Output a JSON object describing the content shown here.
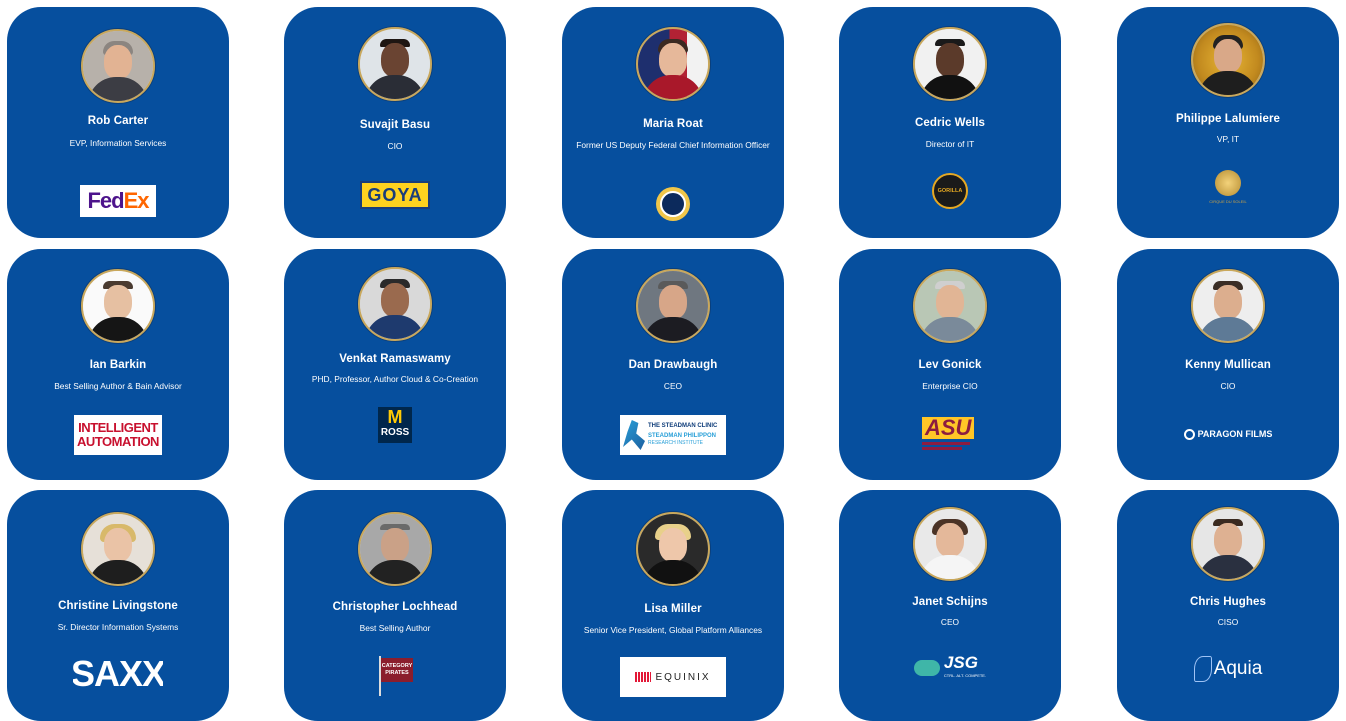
{
  "cards": [
    {
      "name": "Rob Carter",
      "title": "EVP, Information Services",
      "logo": "FedEx"
    },
    {
      "name": "Suvajit Basu",
      "title": "CIO",
      "logo": "GOYA"
    },
    {
      "name": "Maria Roat",
      "title": "Former US Deputy Federal Chief Information Officer",
      "logo": "navy-seal"
    },
    {
      "name": "Cedric Wells",
      "title": "Director of IT",
      "logo": "GORILLA"
    },
    {
      "name": "Philippe Lalumiere",
      "title": "VP, IT",
      "logo": "CIRQUE DU SOLEIL"
    },
    {
      "name": "Ian Barkin",
      "title": "Best Selling Author & Bain Advisor",
      "logo": "INTELLIGENT AUTOMATION"
    },
    {
      "name": "Venkat Ramaswamy",
      "title": "PHD, Professor, Author Cloud & Co-Creation",
      "logo": "ROSS"
    },
    {
      "name": "Dan Drawbaugh",
      "title": "CEO",
      "logo": "THE STEADMAN CLINIC"
    },
    {
      "name": "Lev Gonick",
      "title": "Enterprise CIO",
      "logo": "ASU"
    },
    {
      "name": "Kenny Mullican",
      "title": "CIO",
      "logo": "PARAGON FILMS"
    },
    {
      "name": "Christine Livingstone",
      "title": "Sr. Director Information Systems",
      "logo": "SAXX"
    },
    {
      "name": "Christopher Lochhead",
      "title": "Best Selling Author",
      "logo": "CATEGORY PIRATES"
    },
    {
      "name": "Lisa Miller",
      "title": "Senior Vice President, Global Platform Alliances",
      "logo": "EQUINIX"
    },
    {
      "name": "Janet Schijns",
      "title": "CEO",
      "logo": "JSG"
    },
    {
      "name": "Chris Hughes",
      "title": "CISO",
      "logo": "Aquia"
    }
  ],
  "logos": {
    "fedex_fed": "Fed",
    "fedex_ex": "Ex",
    "goya": "GOYA",
    "gorilla": "GORILLA",
    "cirque_small": "CIRQUE DU SOLEIL",
    "ia_line1": "INTELLIGENT",
    "ia_line2": "AUTOMATION",
    "ross_m": "M",
    "ross": "ROSS",
    "steadman1": "THE STEADMAN CLINIC",
    "steadman2": "STEADMAN PHILIPPON",
    "steadman3": "RESEARCH INSTITUTE",
    "asu": "ASU",
    "paragon": "PARAGON FILMS",
    "saxx": "SAXX",
    "cp1": "CATEGORY",
    "cp2": "PIRATES",
    "equinix": "EQUINIX",
    "jsg": "JSG",
    "jsg_tag": "CTRL. ALT. COMPETE.",
    "aquia": "Aquia"
  }
}
